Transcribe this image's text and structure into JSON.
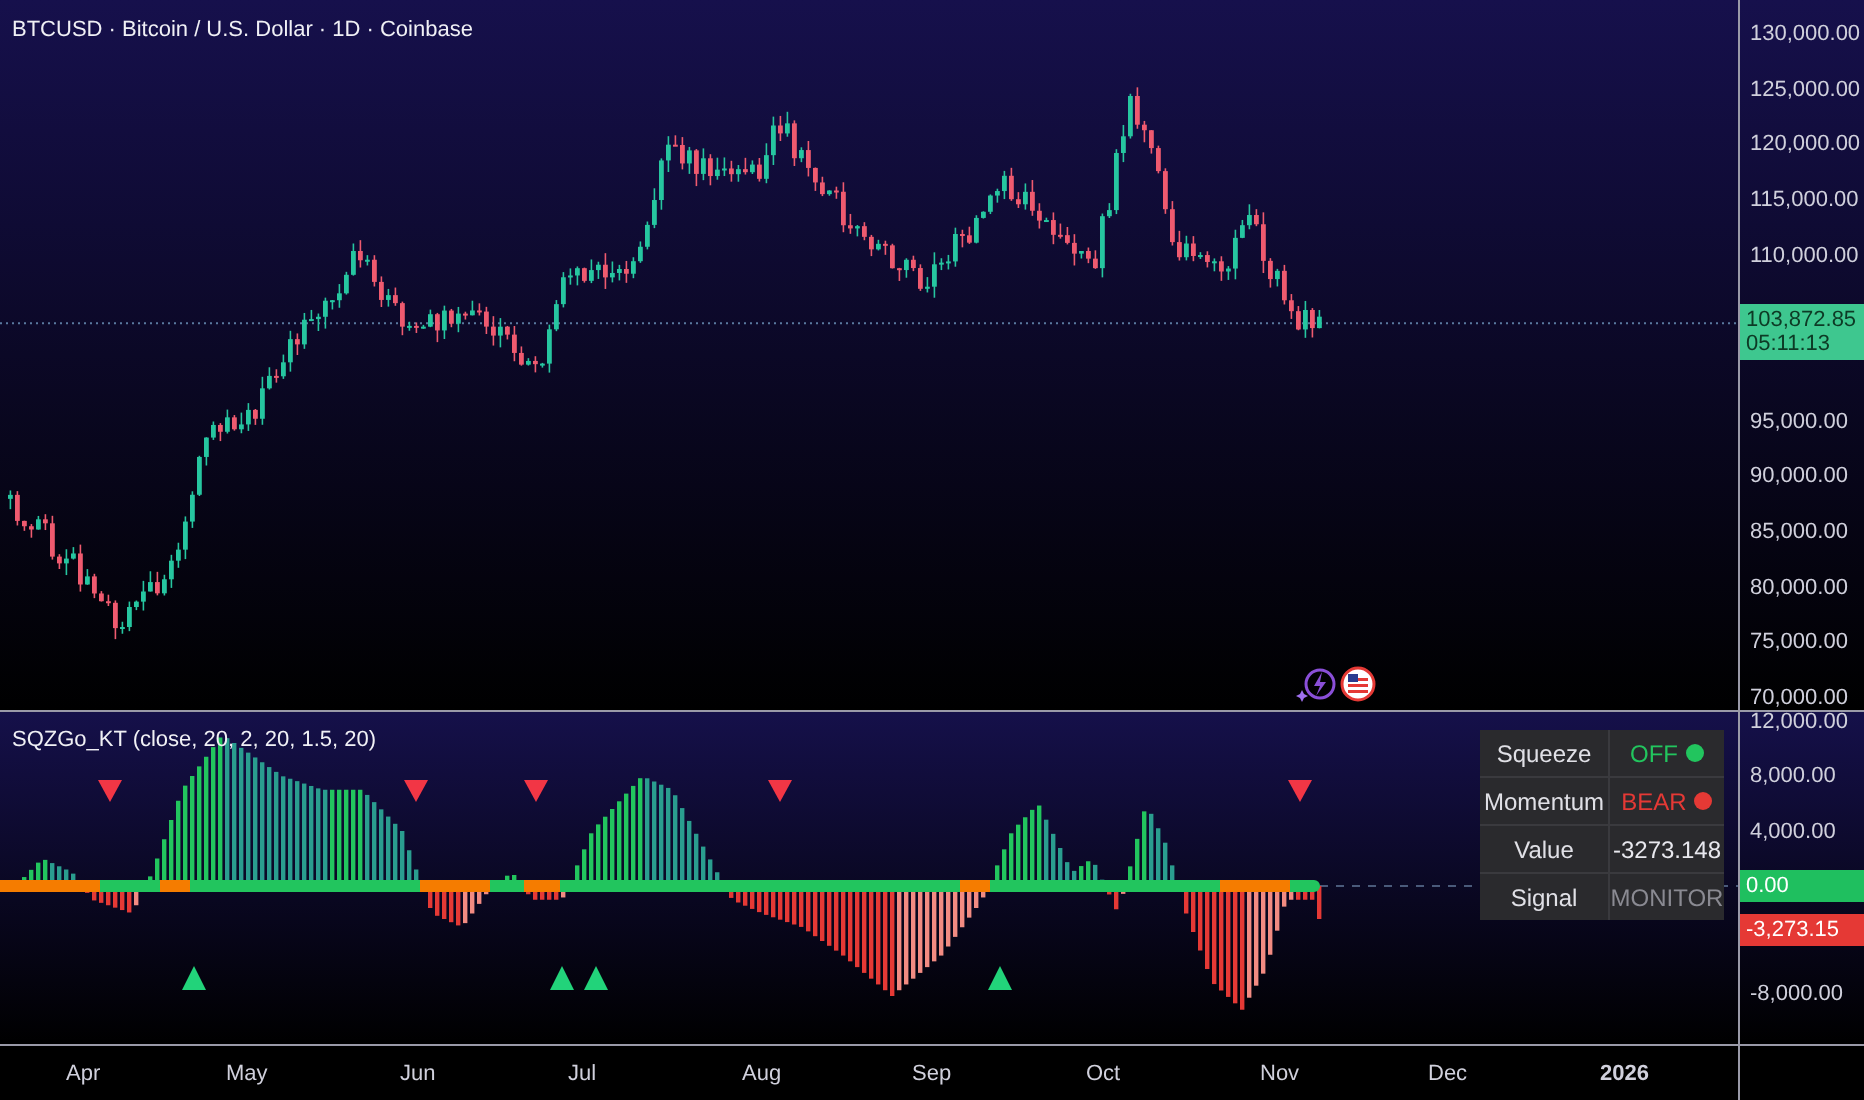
{
  "header": {
    "title": "BTCUSD · Bitcoin / U.S. Dollar · 1D · Coinbase"
  },
  "price_axis": {
    "ticks": [
      "130,000.00",
      "125,000.00",
      "120,000.00",
      "115,000.00",
      "110,000.00",
      "95,000.00",
      "90,000.00",
      "85,000.00",
      "80,000.00",
      "75,000.00",
      "70,000.00"
    ],
    "last_price": "103,872.85",
    "countdown": "05:11:13"
  },
  "indicator": {
    "title": "SQZGo_KT (close, 20, 2, 20, 1.5, 20)",
    "axis_ticks": [
      "12,000.00",
      "8,000.00",
      "4,000.00",
      "-8,000.00"
    ],
    "zero_label": "0.00",
    "value_label": "-3,273.15",
    "table": {
      "rows": [
        {
          "label": "Squeeze",
          "value": "OFF",
          "kind": "status",
          "color": "#22c55e"
        },
        {
          "label": "Momentum",
          "value": "BEAR",
          "kind": "status",
          "color": "#e53935"
        },
        {
          "label": "Value",
          "value": "-3273.148",
          "kind": "text"
        },
        {
          "label": "Signal",
          "value": "MONITOR",
          "kind": "muted"
        }
      ]
    }
  },
  "time_axis": [
    {
      "label": "Apr",
      "kind": "month"
    },
    {
      "label": "May",
      "kind": "month"
    },
    {
      "label": "Jun",
      "kind": "month"
    },
    {
      "label": "Jul",
      "kind": "month"
    },
    {
      "label": "Aug",
      "kind": "month"
    },
    {
      "label": "Sep",
      "kind": "month"
    },
    {
      "label": "Oct",
      "kind": "month"
    },
    {
      "label": "Nov",
      "kind": "month"
    },
    {
      "label": "Dec",
      "kind": "month"
    },
    {
      "label": "2026",
      "kind": "year"
    }
  ]
}
